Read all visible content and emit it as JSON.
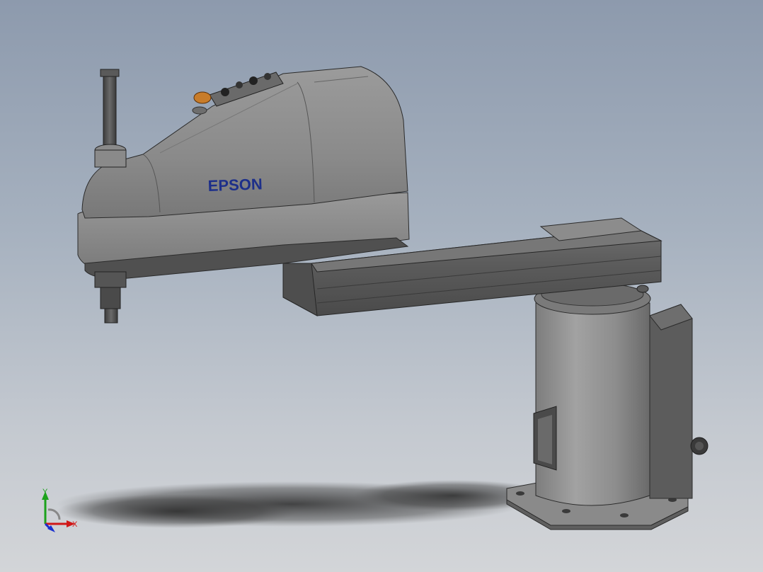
{
  "viewport": {
    "background_top": "#8d9aad",
    "background_bottom": "#d3d5d8"
  },
  "model": {
    "logo_text": "EPSON",
    "logo_color": "#1d2f8a",
    "body_color": "#8f8f8f",
    "dark_color": "#4d4d4d",
    "indicator_color": "#c87c2a"
  },
  "triad": {
    "x_label": "X",
    "y_label": "Y",
    "x_color": "#d01818",
    "y_color": "#1ca21c",
    "z_color": "#1a2fd0"
  }
}
